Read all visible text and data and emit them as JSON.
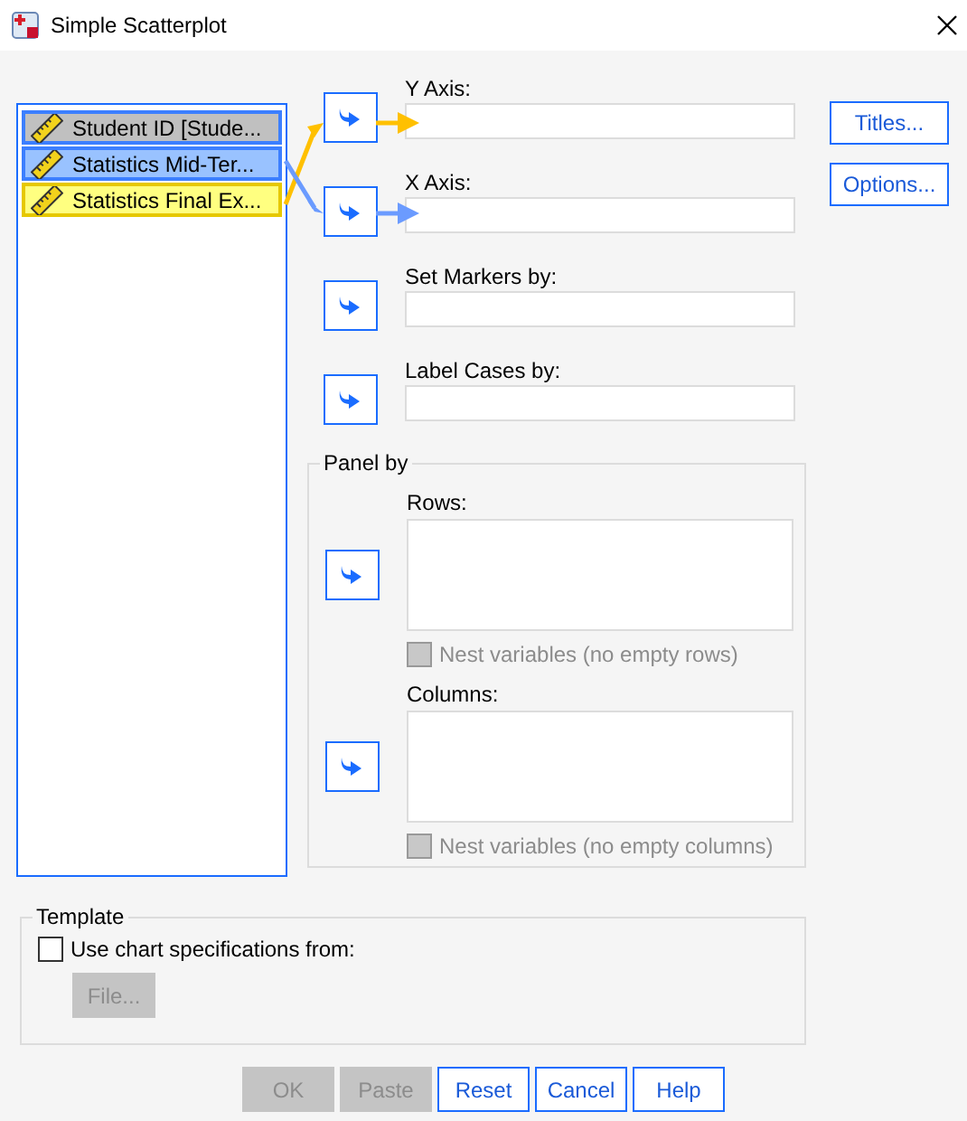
{
  "window": {
    "title": "Simple Scatterplot"
  },
  "variables": [
    {
      "label": "Student ID [Stude...",
      "color": "#c0c0c0"
    },
    {
      "label": "Statistics Mid-Ter...",
      "color": "#99c2ff"
    },
    {
      "label": "Statistics Final Ex...",
      "color": "#ffff80"
    }
  ],
  "targets": [
    {
      "label": "Y Axis:",
      "connector": {
        "color": "#ffc000"
      }
    },
    {
      "label": "X Axis:",
      "connector": {
        "color": "#6b9bff"
      }
    },
    {
      "label": "Set Markers by:"
    },
    {
      "label": "Label Cases by:"
    }
  ],
  "side_buttons": [
    "Titles...",
    "Options..."
  ],
  "panel": {
    "title": "Panel by",
    "lists": [
      {
        "label": "Rows:",
        "nest": {
          "label": "Nest variables (no empty rows)",
          "checked": false,
          "disabled": true
        }
      },
      {
        "label": "Columns:",
        "nest": {
          "label": "Nest variables (no empty columns)",
          "checked": false,
          "disabled": true
        }
      }
    ]
  },
  "template": {
    "title": "Template",
    "checkbox": {
      "label": "Use chart specifications from:",
      "checked": false
    },
    "file_button": {
      "label": "File...",
      "disabled": true
    }
  },
  "buttons": [
    {
      "label": "OK",
      "disabled": true
    },
    {
      "label": "Paste",
      "disabled": true
    },
    {
      "label": "Reset",
      "disabled": false
    },
    {
      "label": "Cancel",
      "disabled": false
    },
    {
      "label": "Help",
      "disabled": false
    }
  ]
}
